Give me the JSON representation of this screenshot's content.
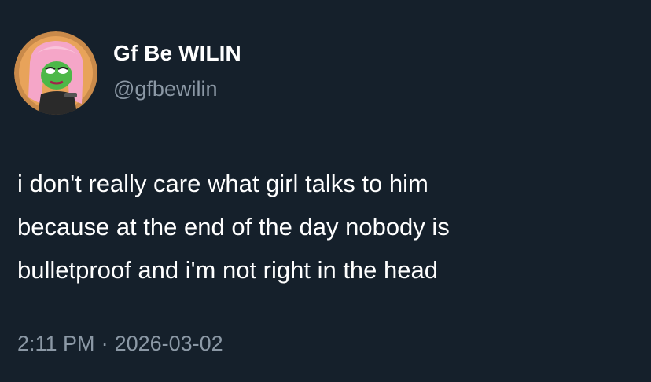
{
  "author": {
    "display_name": "Gf Be WILIN",
    "handle": "@gfbewilin",
    "avatar_icon": "cartoon-frog-girl-avatar-icon"
  },
  "tweet": {
    "lines": [
      "i don't really care what girl talks to him",
      "because at the end of the day nobody is",
      "bulletproof and i'm not right in the head"
    ]
  },
  "meta": {
    "time": "2:11 PM",
    "separator": "·",
    "date": "2026-03-02"
  },
  "colors": {
    "background": "#15202b",
    "primary_text": "#ffffff",
    "secondary_text": "#8b98a5",
    "avatar_ring": "#c98a4a"
  }
}
